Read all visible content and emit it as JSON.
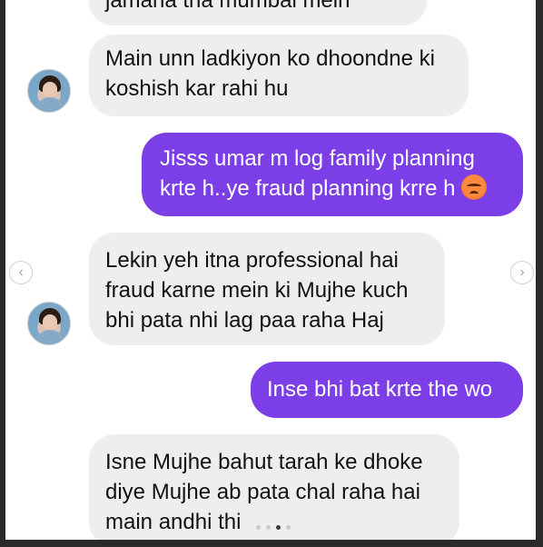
{
  "messages": [
    {
      "side": "in",
      "text": "jamana tha mumbai mein"
    },
    {
      "side": "in",
      "text": "Main unn ladkiyon ko dhoondne ki koshish kar rahi hu"
    },
    {
      "side": "out",
      "text": "Jisss umar m log family planning krte h..ye fraud planning krre h",
      "emoji": "angry-face"
    },
    {
      "side": "in",
      "text": "Lekin yeh itna professional hai fraud karne mein ki Mujhe kuch bhi pata nhi lag paa raha Haj"
    },
    {
      "side": "out",
      "text": "Inse bhi bat krte the wo"
    },
    {
      "side": "in",
      "text": "Isne Mujhe bahut tarah ke dhoke diye Mujhe ab pata chal raha hai main andhi thi"
    }
  ],
  "nav": {
    "prev_icon": "‹",
    "next_icon": "›"
  },
  "carousel": {
    "count": 4,
    "active": 3
  },
  "colors": {
    "outgoing": "#7c3ee6",
    "incoming": "#eeeeee"
  }
}
